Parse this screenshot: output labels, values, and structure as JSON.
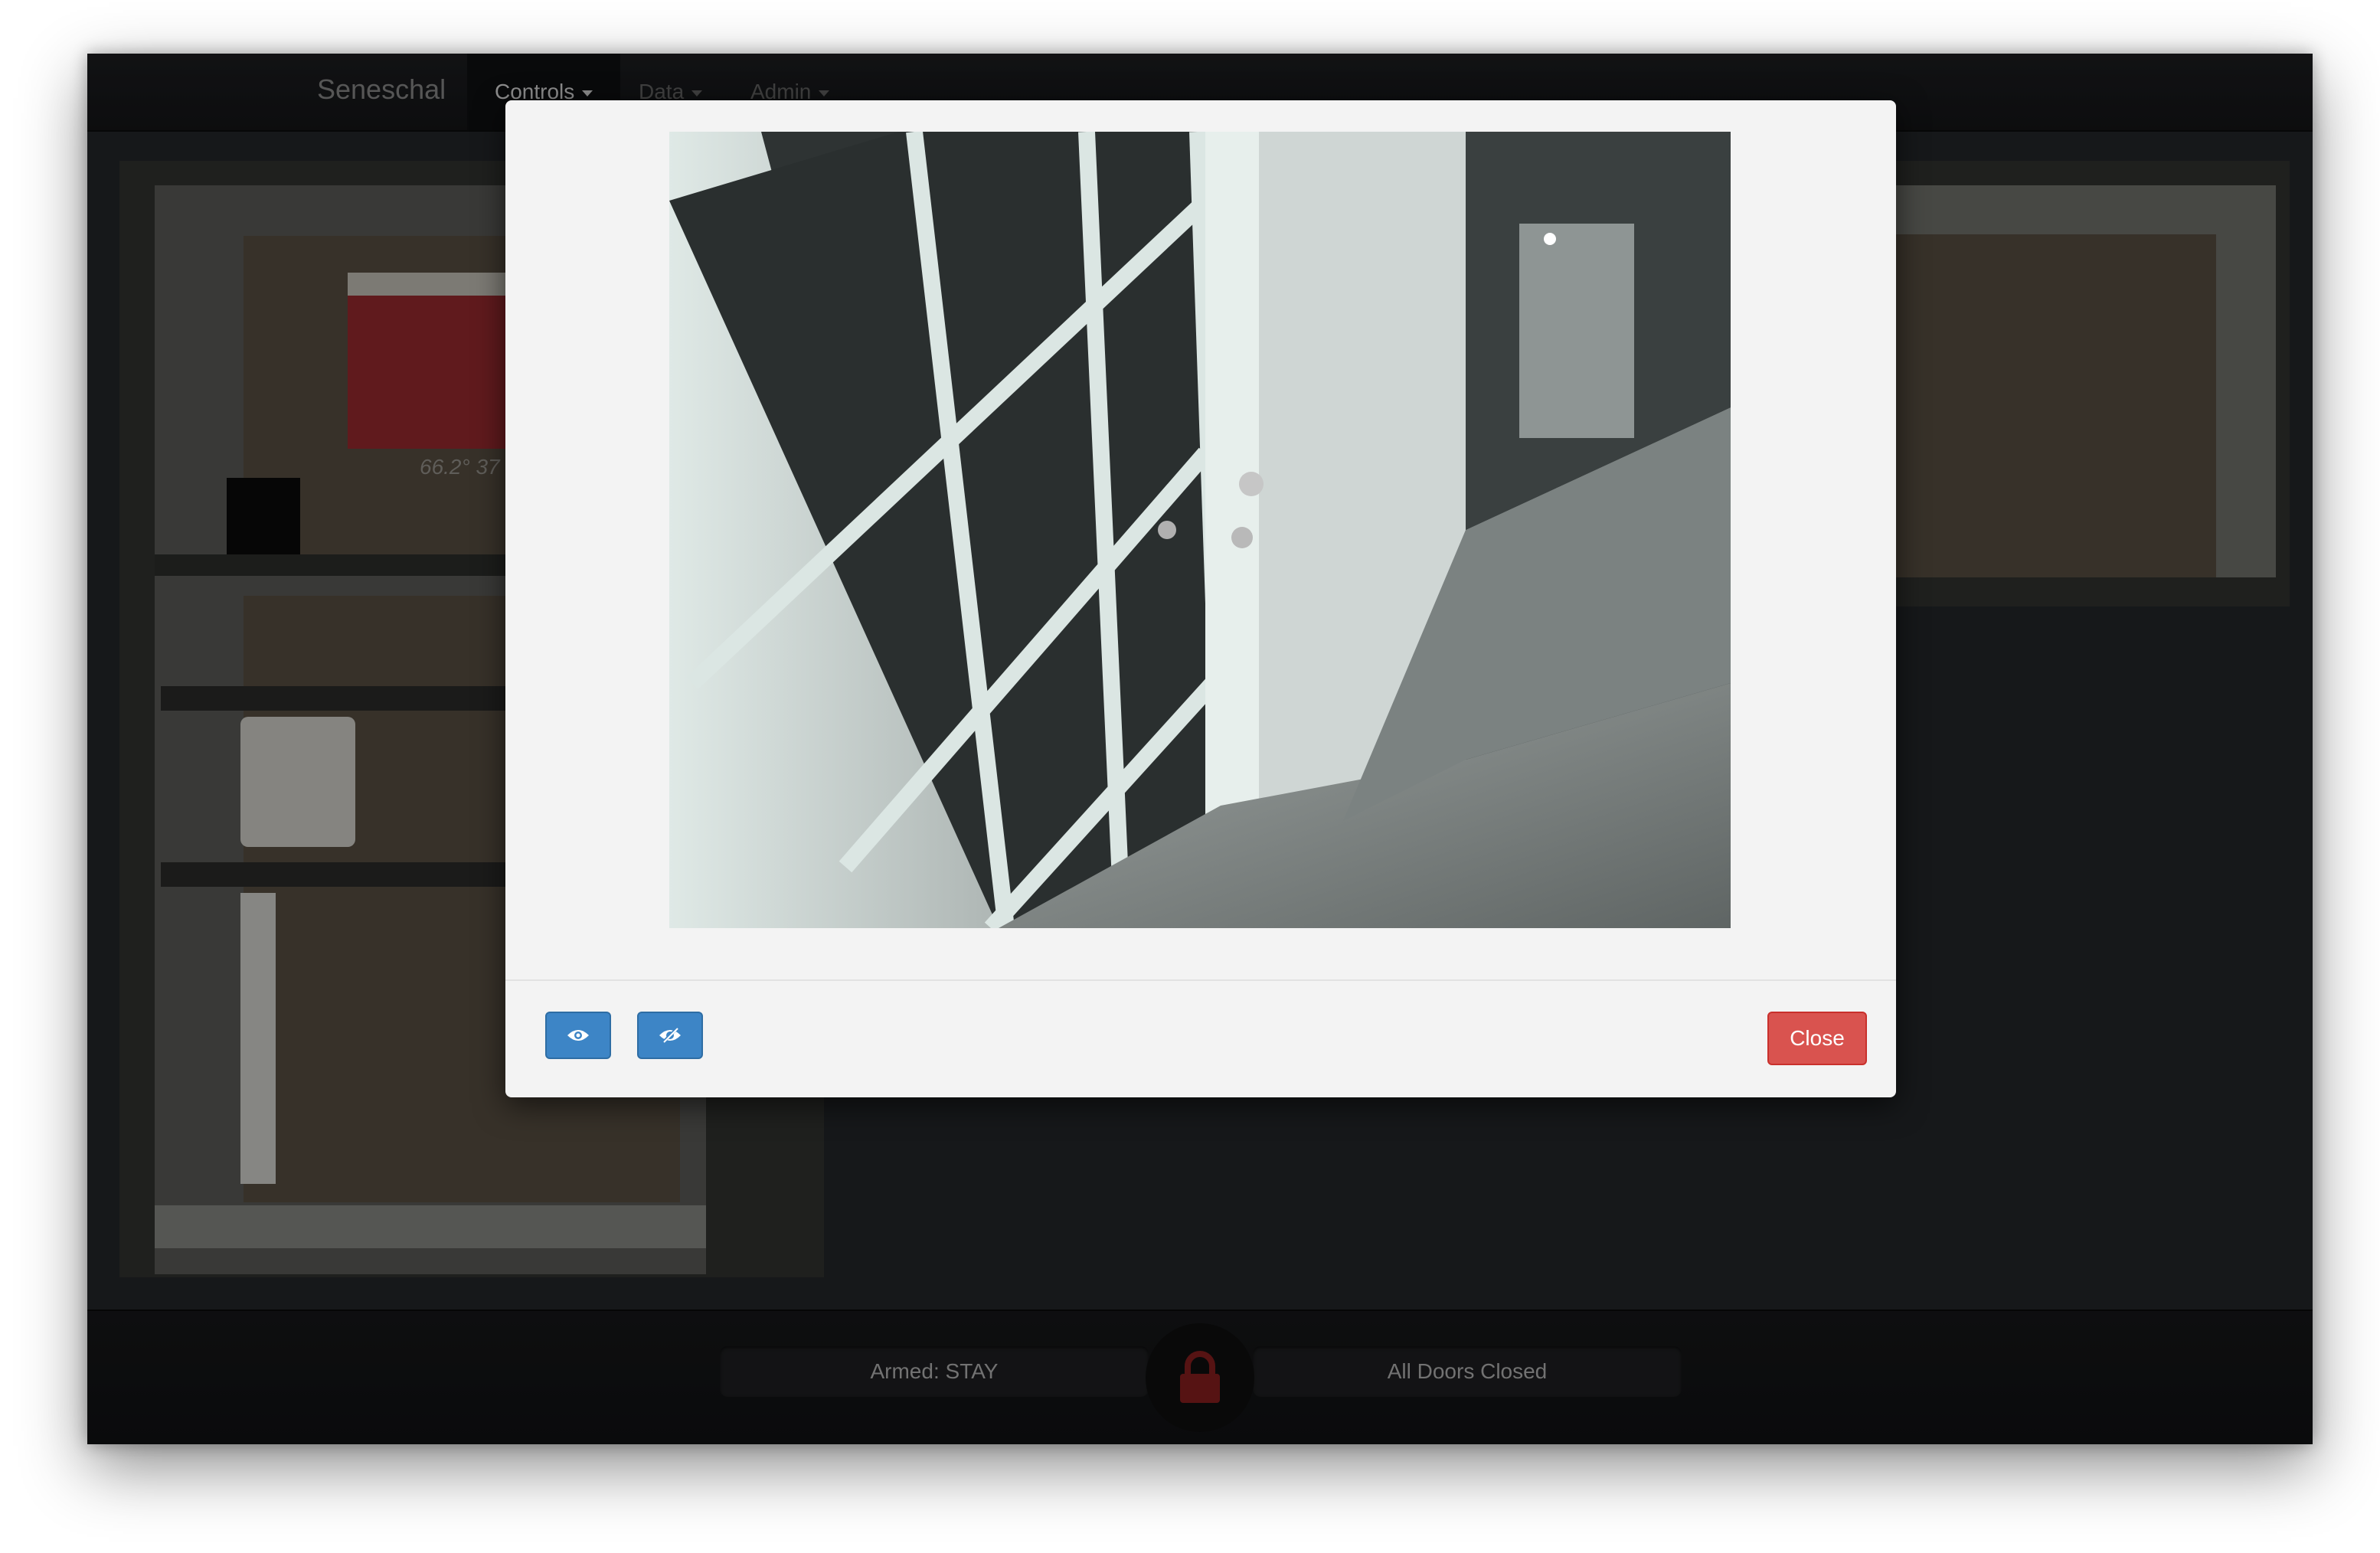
{
  "navbar": {
    "brand": "Seneschal",
    "items": [
      {
        "label": "Controls",
        "active": true
      },
      {
        "label": "Data",
        "active": false
      },
      {
        "label": "Admin",
        "active": false
      }
    ]
  },
  "floorplan": {
    "temperature_text": "66.2° 37"
  },
  "modal": {
    "camera_feed_icon": "camera-feed-image",
    "buttons": [
      {
        "icon": "eye-icon"
      },
      {
        "icon": "eye-slash-icon"
      }
    ],
    "close_label": "Close"
  },
  "status": {
    "armed_label": "Armed: STAY",
    "doors_label": "All Doors Closed",
    "lock_icon": "lock-icon",
    "lock_color": "#8b1f1f"
  },
  "colors": {
    "primary_button": "#3d85c6",
    "danger_button": "#d9534f"
  }
}
